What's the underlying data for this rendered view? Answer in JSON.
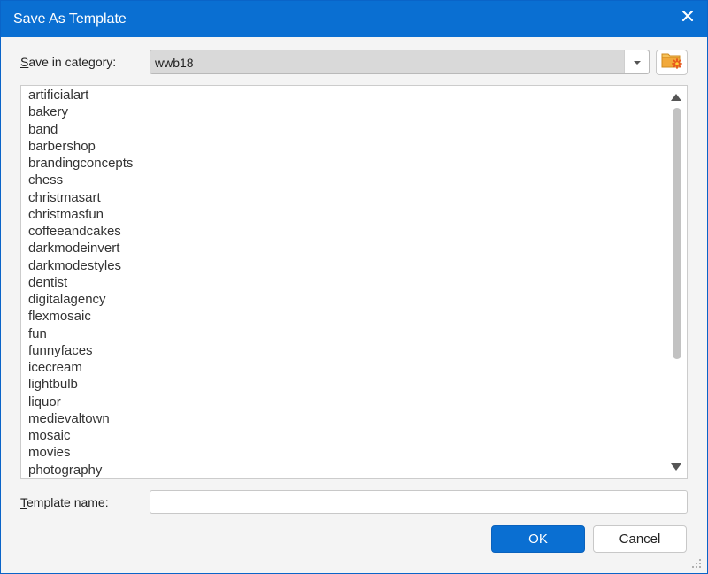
{
  "dialog": {
    "title": "Save As Template",
    "close_glyph": "✕"
  },
  "category": {
    "label_accel": "S",
    "label_rest": "ave in category:",
    "value": "wwb18",
    "new_category_icon": "folder-new-icon"
  },
  "templates": [
    "artificialart",
    "bakery",
    "band",
    "barbershop",
    "brandingconcepts",
    "chess",
    "christmasart",
    "christmasfun",
    "coffeeandcakes",
    "darkmodeinvert",
    "darkmodestyles",
    "dentist",
    "digitalagency",
    "flexmosaic",
    "fun",
    "funnyfaces",
    "icecream",
    "lightbulb",
    "liquor",
    "medievaltown",
    "mosaic",
    "movies",
    "photography"
  ],
  "template_name": {
    "label_accel": "T",
    "label_rest": "emplate name:",
    "value": ""
  },
  "buttons": {
    "ok": "OK",
    "cancel": "Cancel"
  },
  "colors": {
    "accent": "#0a6fd2",
    "folder": "#f2a93b",
    "folder_star": "#e8541c"
  }
}
